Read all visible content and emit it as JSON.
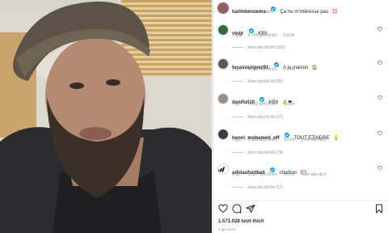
{
  "post": {
    "author": "karimbenzema",
    "caption": "Ça ne m'intéresse pas",
    "caption_emoji": "💢",
    "time": "2 giờ",
    "translate": "Xem bản dịch"
  },
  "comments": [
    {
      "username": "vinijr",
      "verified": true,
      "text": "KB9",
      "emoji": "",
      "time": "1 giờ",
      "likes": "8.750 lượt thích",
      "reply": "Trả lời",
      "translate": "",
      "replies": "Xem câu trả lời (115)",
      "avatar_color": "#2f6b3a"
    },
    {
      "username": "lucasvazquez91",
      "verified": true,
      "text": "A la maison",
      "emoji": "🏠",
      "time": "1 giờ",
      "likes": "4.093 lượt thích",
      "reply": "Trả lời",
      "translate": "",
      "replies": "Xem câu trả lời (30)",
      "avatar_color": "#5a5a5a"
    },
    {
      "username": "danifuli10",
      "verified": true,
      "text": "KB9",
      "emoji": "👌❤",
      "time": "1 giờ",
      "likes": "3.632 lượt thích",
      "reply": "Trả lời",
      "translate": "",
      "replies": "Xem câu trả lời (17)",
      "avatar_color": "#9a8e86"
    },
    {
      "username": "henni_mohamed_off",
      "verified": true,
      "text": "TOUT ETINDRE",
      "emoji": "💡",
      "time": "1 giờ",
      "likes": "1.980 lượt thích",
      "reply": "Trả lời",
      "translate": "Xem bản dịch",
      "replies": "Xem câu trả lời (76)",
      "avatar_color": "#3b3b3b"
    },
    {
      "username": "adidasfootball",
      "verified": true,
      "text": "charbon",
      "emoji": "🥅",
      "time": "1 giờ",
      "likes": "2.597 lượt thích",
      "reply": "Trả lời",
      "translate": "Xem bản dịch",
      "replies": "Xem câu trả lời (17)",
      "avatar_color": "#ffffff"
    }
  ],
  "footer": {
    "likes": "1.571.028 lượt thích",
    "ago": "2 giờ trước"
  },
  "colors": {
    "verified": "#0095f6",
    "text": "#262626",
    "muted": "#8e8e8e"
  },
  "icons": [
    "heart-icon",
    "comment-icon",
    "share-icon",
    "bookmark-icon",
    "verified-badge-icon",
    "more-icon"
  ]
}
